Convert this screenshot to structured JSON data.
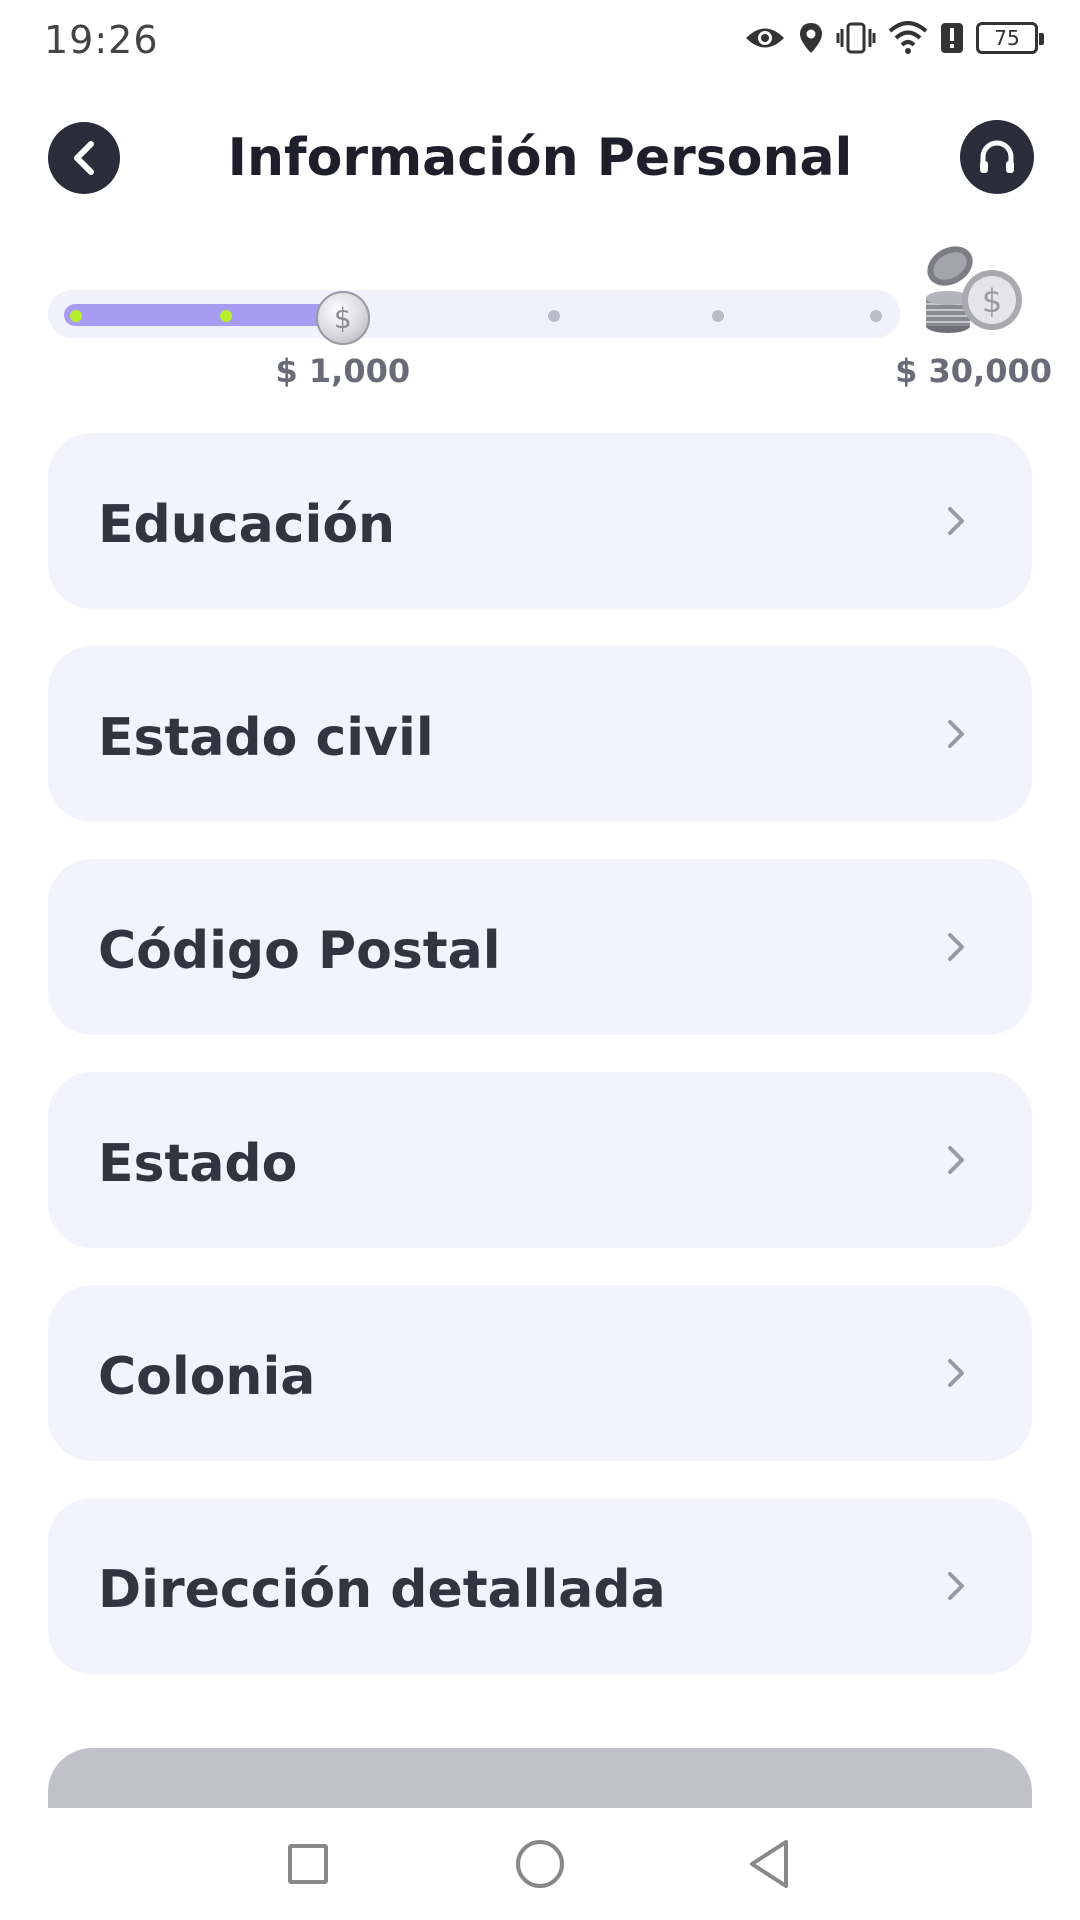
{
  "status_bar": {
    "time": "19:26",
    "battery": "75",
    "icons": [
      "eye-icon",
      "location-icon",
      "vibrate-icon",
      "wifi-icon",
      "alert-icon",
      "battery-icon"
    ]
  },
  "header": {
    "title": "Información Personal",
    "back_icon": "chevron-left-icon",
    "support_icon": "headset-icon"
  },
  "progress": {
    "current_amount": "$ 1,000",
    "max_amount": "$ 30,000",
    "fill_fraction": 0.34,
    "colors": {
      "fill": "#a79cf2",
      "done_dot": "#b7f02a",
      "pending_dot": "#bcbcc8"
    }
  },
  "items": [
    {
      "label": "Educación"
    },
    {
      "label": "Estado civil"
    },
    {
      "label": "Código Postal"
    },
    {
      "label": "Estado"
    },
    {
      "label": "Colonia"
    },
    {
      "label": "Dirección detallada"
    }
  ],
  "submit": {
    "state": "disabled",
    "color": "#c1c1c9"
  },
  "nav": {
    "icons": [
      "recent-apps-icon",
      "home-icon",
      "back-icon"
    ]
  }
}
